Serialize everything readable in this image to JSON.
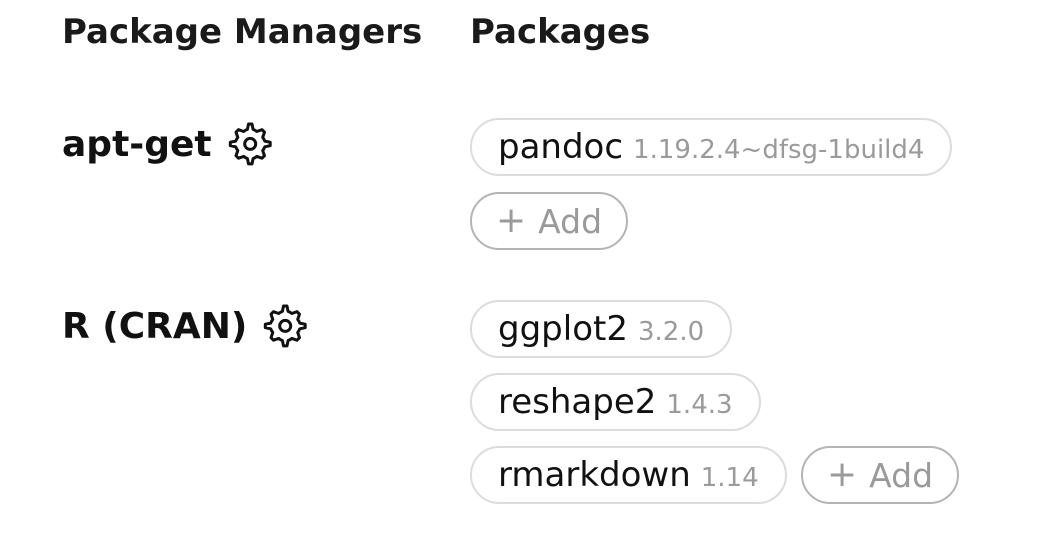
{
  "headers": {
    "managers": "Package Managers",
    "packages": "Packages"
  },
  "managers": [
    {
      "name": "apt-get",
      "icon": "gear-icon",
      "packages": [
        {
          "name": "pandoc",
          "version": "1.19.2.4~dfsg-1build4"
        }
      ],
      "add_label": "Add"
    },
    {
      "name": "R (CRAN)",
      "icon": "gear-icon",
      "packages": [
        {
          "name": "ggplot2",
          "version": "3.2.0"
        },
        {
          "name": "reshape2",
          "version": "1.4.3"
        },
        {
          "name": "rmarkdown",
          "version": "1.14"
        }
      ],
      "add_label": "Add"
    }
  ],
  "colors": {
    "text": "#111111",
    "version_text": "#9a9a9a",
    "pill_border": "#dcdcdc",
    "add_border": "#b4b4b4"
  }
}
